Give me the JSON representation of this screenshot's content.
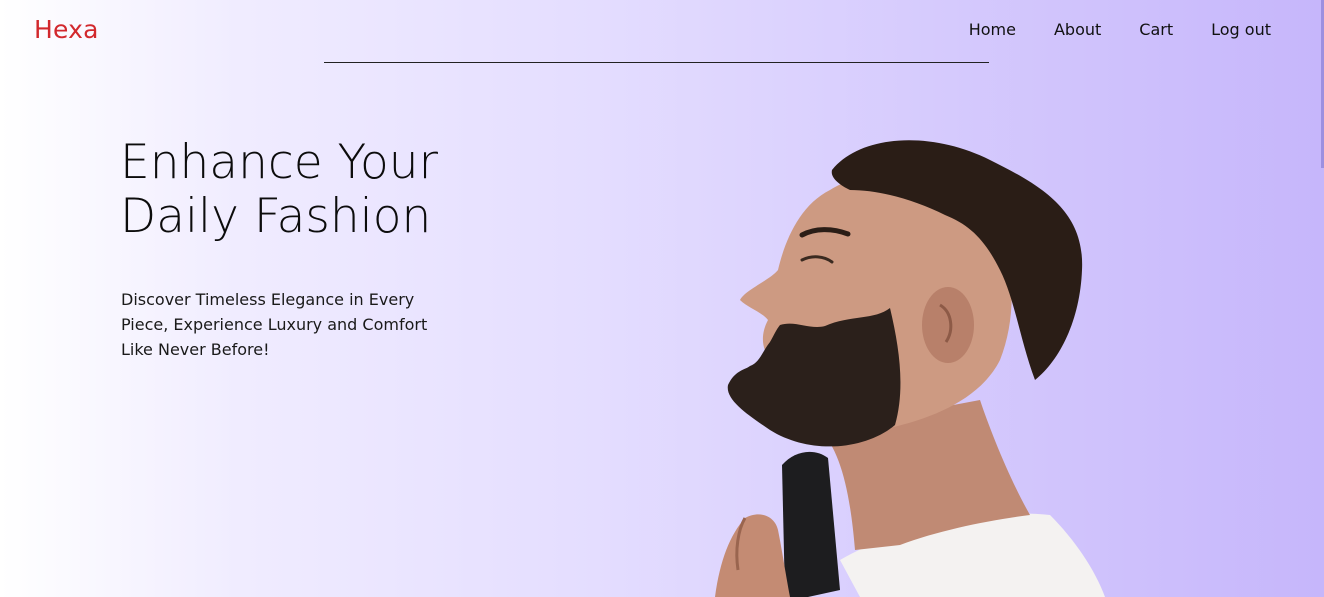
{
  "brand": {
    "name": "Hexa",
    "color": "#d2282d"
  },
  "nav": {
    "items": [
      {
        "label": "Home"
      },
      {
        "label": "About"
      },
      {
        "label": "Cart"
      },
      {
        "label": "Log out"
      }
    ]
  },
  "hero": {
    "title_line1": "Enhance Your",
    "title_line2": "Daily Fashion",
    "subtitle_line1": "Discover Timeless Elegance in Every",
    "subtitle_line2": "Piece, Experience Luxury and Comfort",
    "subtitle_line3": "Like Never Before!",
    "image_icon": "man-profile-trimming-beard-image"
  },
  "theme": {
    "gradient_start": "#ffffff",
    "gradient_end": "#c6b6fb"
  }
}
